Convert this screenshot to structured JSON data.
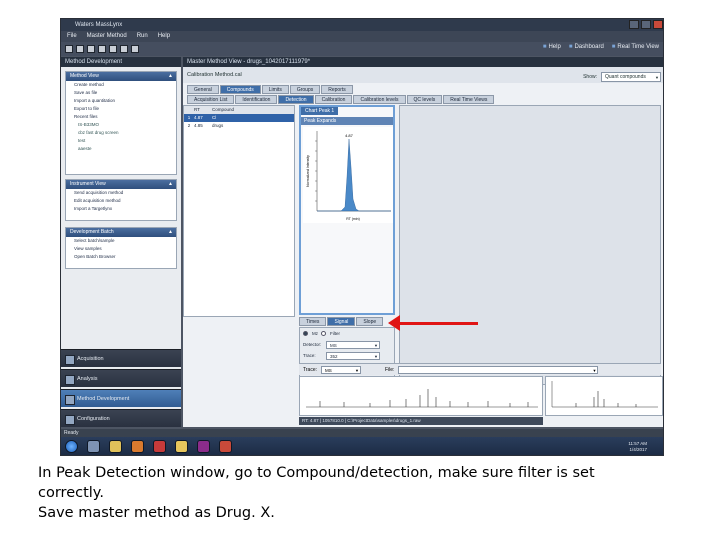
{
  "window": {
    "title": "Waters MassLynx",
    "menu": [
      "File",
      "Master Method",
      "Run",
      "Help"
    ]
  },
  "toolbar": {
    "help_label": "Help",
    "dashboard_label": "Dashboard",
    "realtime_label": "Real Time View"
  },
  "left_panel": {
    "header": "Method Development",
    "group1": {
      "title": "Method View",
      "items": [
        "Create method",
        "Save as file",
        "Import a quantitation",
        "Export to file",
        "Recent files"
      ],
      "recent": [
        "IS-B33MO",
        "cbz fast drug screen",
        "test",
        "aaeste"
      ]
    },
    "group2": {
      "title": "Instrument View",
      "items": [
        "Send acquisition method",
        "Edit acquisition method",
        "Import a Targetlynx"
      ]
    },
    "group3": {
      "title": "Development Batch",
      "items": [
        "Select batch/sample",
        "View samples",
        "Open Batch Browser"
      ]
    }
  },
  "nav": {
    "acquisition": "Acquisition",
    "analysis": "Analysis",
    "method_development": "Method Development",
    "configuration": "Configuration"
  },
  "main": {
    "header": "Master Method View - drugs_1042017111979*",
    "subheader": "Calibration Method.cal",
    "show_label": "Show:",
    "show_value": "Quant compounds",
    "tabs": [
      "General",
      "Compounds",
      "Limits",
      "Groups",
      "Reports"
    ],
    "subtabs": [
      "Acquisition List",
      "Identification",
      "Detection",
      "Calibration",
      "Calibration levels",
      "QC levels",
      "Real Time Views"
    ]
  },
  "grid": {
    "headers": [
      "",
      "RT",
      "Compound"
    ],
    "rows": [
      {
        "index": "1",
        "rt": "4.87",
        "compound": "Cl"
      },
      {
        "index": "2",
        "rt": "4.85",
        "compound": "drugs"
      }
    ]
  },
  "peak_pane": {
    "tag": "Chart Peak 1",
    "title": "Peak Expands",
    "y_axis_label": "Normalized Intensity",
    "x_axis_label": "RT (min)",
    "peak_label": "4.87"
  },
  "peak_tabs": [
    "Times",
    "Signal",
    "Slope"
  ],
  "form": {
    "radio_on": "Mz",
    "radio_off": "Filter",
    "detector_label": "Detector:",
    "detector_value": "MS",
    "trace_label": "Trace:",
    "trace_value": "352",
    "filter_label": "Filter:",
    "filter_value": "Adjacent Averaging"
  },
  "bottom": {
    "trace_label": "Trace:",
    "trace_value": "MS",
    "file_label": "File:"
  },
  "status_line": "RT: 4.87 | 1057810.0 | C:\\ProjectData\\samples\\drugs_1.raw",
  "status_ready": "Ready",
  "clock": {
    "time": "11:57 AM",
    "date": "1/4/2017"
  },
  "caption": {
    "line1": "In Peak Detection window, go to Compound/detection, make sure filter is set",
    "line2": "correctly.",
    "line3": "Save master method as Drug. X."
  },
  "colors": {
    "accent": "#3f6ea8",
    "arrow": "#e01515",
    "peak": "#4a89c8"
  }
}
